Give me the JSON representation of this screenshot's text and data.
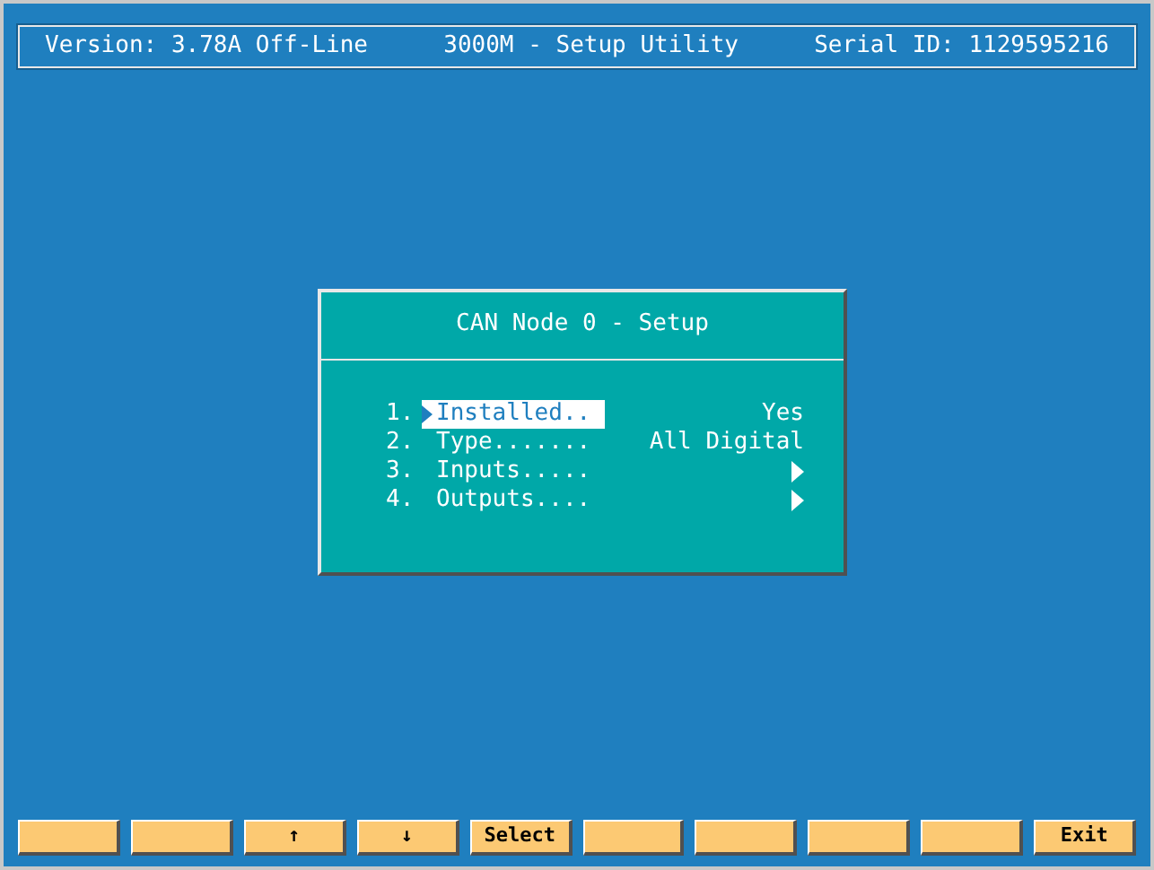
{
  "header": {
    "version": "Version: 3.78A Off-Line",
    "title": "3000M - Setup Utility",
    "serial": "Serial ID: 1129595216"
  },
  "dialog": {
    "title": "CAN Node 0 - Setup",
    "items": [
      {
        "number": "1.",
        "label": "Installed..",
        "kind": "value",
        "value": "Yes",
        "selected": true
      },
      {
        "number": "2.",
        "label": "Type.......",
        "kind": "value",
        "value": "All Digital",
        "selected": false
      },
      {
        "number": "3.",
        "label": "Inputs.....",
        "kind": "submenu",
        "selected": false
      },
      {
        "number": "4.",
        "label": "Outputs....",
        "kind": "submenu",
        "selected": false
      }
    ]
  },
  "function_keys": [
    {
      "kind": "blank"
    },
    {
      "kind": "blank"
    },
    {
      "kind": "labeled",
      "label": "↑"
    },
    {
      "kind": "labeled",
      "label": "↓"
    },
    {
      "kind": "labeled",
      "label": "Select"
    },
    {
      "kind": "blank"
    },
    {
      "kind": "blank"
    },
    {
      "kind": "blank"
    },
    {
      "kind": "blank"
    },
    {
      "kind": "labeled",
      "label": "Exit"
    }
  ]
}
